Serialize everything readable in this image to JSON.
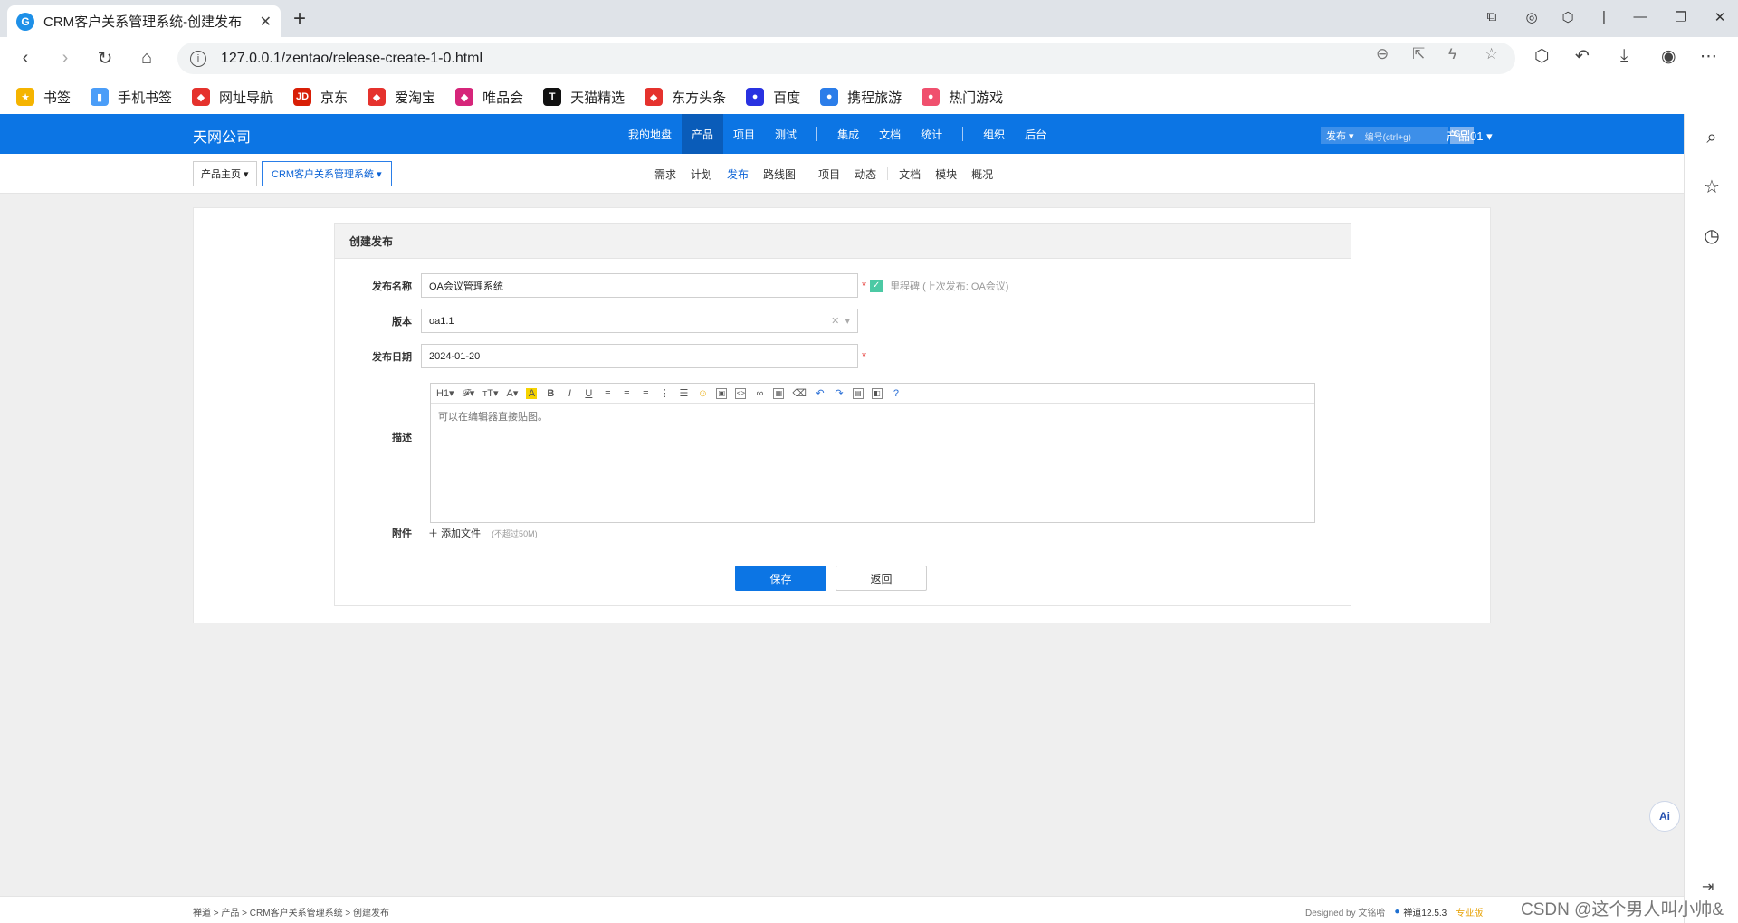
{
  "browser": {
    "tab_title": "CRM客户关系管理系统-创建发布",
    "url": "127.0.0.1/zentao/release-create-1-0.html",
    "bookmarks": [
      {
        "label": "书签",
        "icon": "star-icon",
        "color": "#f5b400"
      },
      {
        "label": "手机书签",
        "icon": "phone-icon",
        "color": "#4a9df8"
      },
      {
        "label": "网址导航",
        "icon": "nav-icon",
        "color": "#e5322d"
      },
      {
        "label": "京东",
        "icon": "jd-icon",
        "color": "#d81e06"
      },
      {
        "label": "爱淘宝",
        "icon": "taobao-icon",
        "color": "#e5322d"
      },
      {
        "label": "唯品会",
        "icon": "vip-icon",
        "color": "#d6257a"
      },
      {
        "label": "天猫精选",
        "icon": "tmall-icon",
        "color": "#111111"
      },
      {
        "label": "东方头条",
        "icon": "news-icon",
        "color": "#e5322d"
      },
      {
        "label": "百度",
        "icon": "baidu-icon",
        "color": "#2932e1"
      },
      {
        "label": "携程旅游",
        "icon": "ctrip-icon",
        "color": "#2b7de9"
      },
      {
        "label": "热门游戏",
        "icon": "game-icon",
        "color": "#f0506e"
      }
    ]
  },
  "app": {
    "company": "天网公司",
    "nav": [
      {
        "label": "我的地盘",
        "active": false
      },
      {
        "label": "产品",
        "active": true
      },
      {
        "label": "项目",
        "active": false
      },
      {
        "label": "测试",
        "active": false
      },
      {
        "label": "|",
        "sep": true
      },
      {
        "label": "集成",
        "active": false
      },
      {
        "label": "文档",
        "active": false
      },
      {
        "label": "统计",
        "active": false
      },
      {
        "label": "|",
        "sep": true
      },
      {
        "label": "组织",
        "active": false
      },
      {
        "label": "后台",
        "active": false
      }
    ],
    "search": {
      "type": "发布",
      "placeholder": "编号(ctrl+g)",
      "go": "GO!"
    },
    "user_product": "产品01"
  },
  "subbar": {
    "crumb_home": "产品主页",
    "crumb_product": "CRM客户关系管理系统",
    "nav": [
      {
        "label": "需求"
      },
      {
        "label": "计划"
      },
      {
        "label": "发布",
        "active": true
      },
      {
        "label": "路线图"
      },
      {
        "sep": true
      },
      {
        "label": "项目"
      },
      {
        "label": "动态"
      },
      {
        "sep": true
      },
      {
        "label": "文档"
      },
      {
        "label": "模块"
      },
      {
        "label": "概况"
      }
    ]
  },
  "form": {
    "title": "创建发布",
    "name_label": "发布名称",
    "name_value": "OA会议管理系统",
    "milestone_label": "里程碑 (上次发布: OA会议)",
    "build_label": "版本",
    "build_value": "oa1.1",
    "date_label": "发布日期",
    "date_value": "2024-01-20",
    "desc_label": "描述",
    "desc_placeholder": "可以在编辑器直接贴图。",
    "attach_label": "附件",
    "attach_button": "添加文件",
    "attach_hint": "(不超过50M)",
    "save": "保存",
    "back": "返回",
    "required_mark": "*"
  },
  "footer": {
    "crumb": "禅道 > 产品 > CRM客户关系管理系统 > 创建发布",
    "designed_by": "Designed by 文铭哈",
    "version": "禅道12.5.3",
    "edition": "专业版",
    "watermark": "CSDN @这个男人叫小帅&"
  },
  "colors": {
    "brand": "#0c75e4",
    "active_nav": "#0a5cb9",
    "required": "#e53935",
    "milestone_check": "#4cc9a4"
  }
}
